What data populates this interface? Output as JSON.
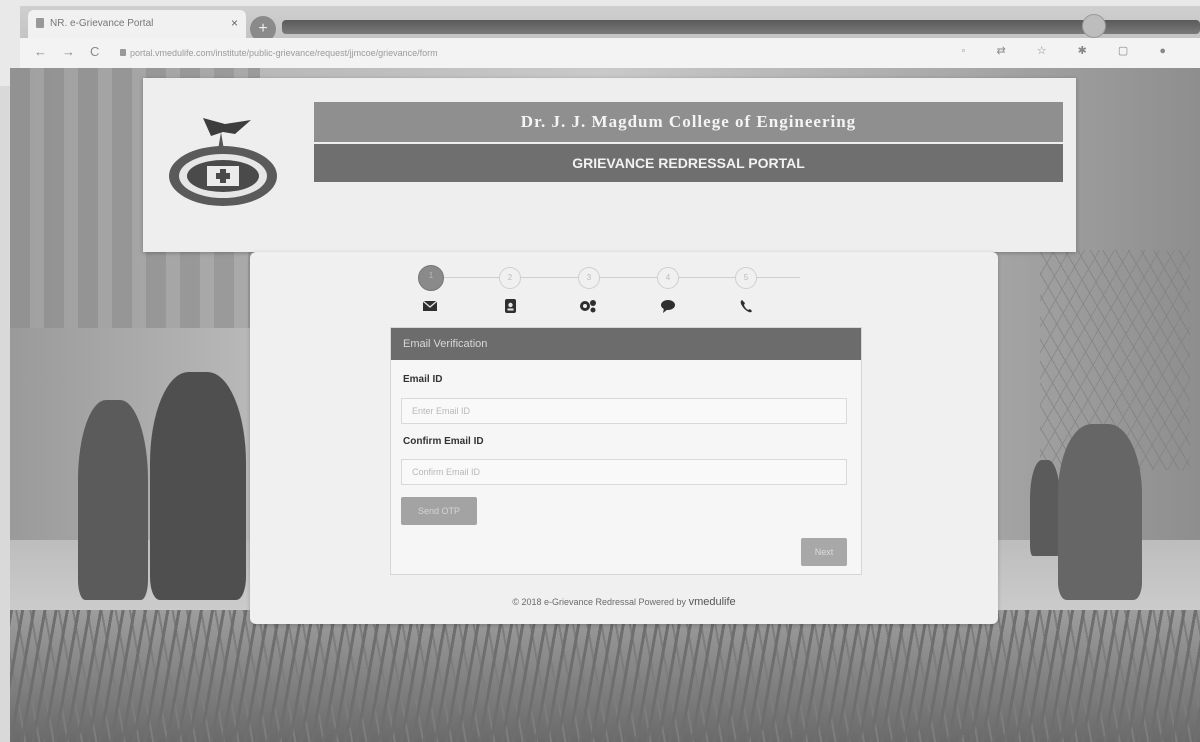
{
  "browser": {
    "tab_title": "NR. e-Grievance Portal",
    "tab_close": "×",
    "new_tab": "+",
    "nav_back": "←",
    "nav_forward": "→",
    "nav_reload": "C",
    "url": "portal.vmedulife.com/institute/public-grievance/request/jjmcoe/grievance/form"
  },
  "header": {
    "college_name": "Dr. J. J. Magdum College of Engineering",
    "portal_name": "GRIEVANCE REDRESSAL PORTAL"
  },
  "stepper": {
    "steps": [
      "1",
      "2",
      "3",
      "4",
      "5"
    ],
    "icons": [
      "envelope-icon",
      "id-card-icon",
      "gears-icon",
      "chat-icon",
      "phone-icon"
    ]
  },
  "form": {
    "panel_title": "Email Verification",
    "email_label": "Email ID",
    "email_placeholder": "Enter Email ID",
    "confirm_label": "Confirm Email ID",
    "confirm_placeholder": "Confirm Email ID",
    "send_otp": "Send OTP",
    "next": "Next"
  },
  "footer": {
    "text": "© 2018 e-Grievance Redressal Powered by",
    "brand": "vmedulife"
  }
}
